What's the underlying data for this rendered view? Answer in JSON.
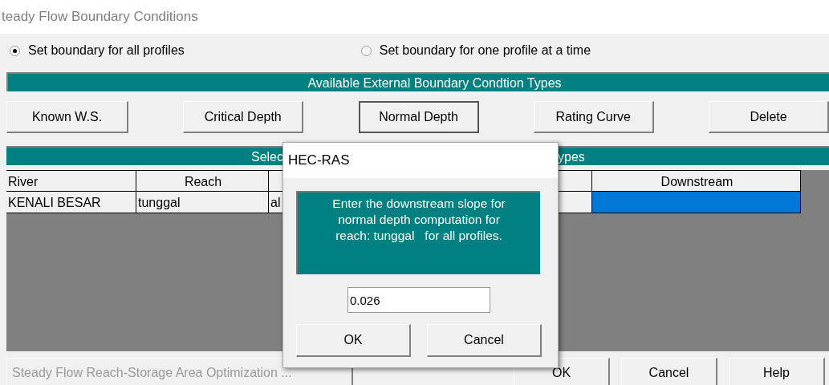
{
  "window": {
    "title": "teady Flow Boundary Conditions"
  },
  "profile_options": [
    {
      "label": "Set boundary for all profiles",
      "selected": true
    },
    {
      "label": "Set boundary for one profile at a time",
      "selected": false
    }
  ],
  "types_header": "Available External Boundary Condtion Types",
  "type_buttons": [
    {
      "label": "Known W.S.",
      "pressed": false
    },
    {
      "label": "Critical Depth",
      "pressed": false
    },
    {
      "label": "Normal Depth",
      "pressed": true
    },
    {
      "label": "Rating Curve",
      "pressed": false
    },
    {
      "label": "Delete",
      "pressed": false
    }
  ],
  "table_header": {
    "left": "Selec",
    "right": "ypes"
  },
  "table": {
    "columns": [
      {
        "label": "River"
      },
      {
        "label": "Reach"
      },
      {
        "label": "Downstream"
      }
    ],
    "rows": [
      {
        "river": "KENALI BESAR",
        "reach": "tunggal",
        "column_3": "al",
        "downstream_selected": true
      }
    ]
  },
  "bottom_buttons": [
    {
      "label": "Steady Flow Reach-Storage Area Optimization ...",
      "disabled": true
    },
    {
      "label": "OK",
      "disabled": false
    },
    {
      "label": "Cancel",
      "disabled": false
    },
    {
      "label": "Help",
      "disabled": false
    }
  ],
  "dialog": {
    "title": "HEC-RAS",
    "message": "Enter the downstream slope for normal depth computation for reach: tunggal   for all profiles.",
    "value": "0.026",
    "buttons": [
      "OK",
      "Cancel"
    ]
  }
}
